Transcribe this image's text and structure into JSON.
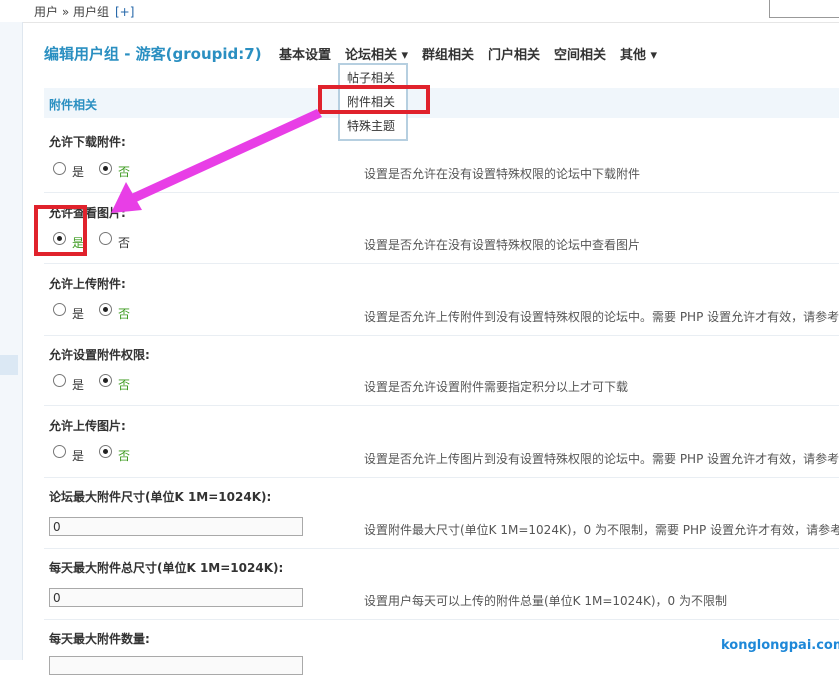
{
  "breadcrumb": {
    "path": "用户 » 用户组",
    "add": "[+]"
  },
  "header": {
    "title": "编辑用户组 - 游客(groupid:7)",
    "tabs": [
      "基本设置",
      "论坛相关 ▾",
      "群组相关",
      "门户相关",
      "空间相关",
      "其他 ▾"
    ]
  },
  "dropdown": {
    "items": [
      "帖子相关",
      "附件相关",
      "特殊主题"
    ]
  },
  "section": {
    "title": "附件相关"
  },
  "settings": [
    {
      "label": "允许下载附件:",
      "yes": "是",
      "no": "否",
      "selected": "no",
      "desc": "设置是否允许在没有设置特殊权限的论坛中下载附件"
    },
    {
      "label": "允许查看图片:",
      "yes": "是",
      "no": "否",
      "selected": "yes",
      "desc": "设置是否允许在没有设置特殊权限的论坛中查看图片"
    },
    {
      "label": "允许上传附件:",
      "yes": "是",
      "no": "否",
      "selected": "no",
      "desc": "设置是否允许上传附件到没有设置特殊权限的论坛中。需要 PHP 设置允许才有效，请参考"
    },
    {
      "label": "允许设置附件权限:",
      "yes": "是",
      "no": "否",
      "selected": "no",
      "desc": "设置是否允许设置附件需要指定积分以上才可下载"
    },
    {
      "label": "允许上传图片:",
      "yes": "是",
      "no": "否",
      "selected": "no",
      "desc": "设置是否允许上传图片到没有设置特殊权限的论坛中。需要 PHP 设置允许才有效，请参考"
    }
  ],
  "inputs": [
    {
      "label": "论坛最大附件尺寸(单位K 1M=1024K):",
      "value": "0",
      "desc": "设置附件最大尺寸(单位K 1M=1024K)，0 为不限制，需要 PHP 设置允许才有效，请参考"
    },
    {
      "label": "每天最大附件总尺寸(单位K 1M=1024K):",
      "value": "0",
      "desc": "设置用户每天可以上传的附件总量(单位K 1M=1024K)，0 为不限制"
    },
    {
      "label": "每天最大附件数量:"
    }
  ],
  "watermark": "konglongpai.com",
  "colors": {
    "accent": "#2a8fc1",
    "selected_option": "#3b9a1e",
    "highlight": "#e0222c",
    "arrow": "#e83ee6"
  }
}
